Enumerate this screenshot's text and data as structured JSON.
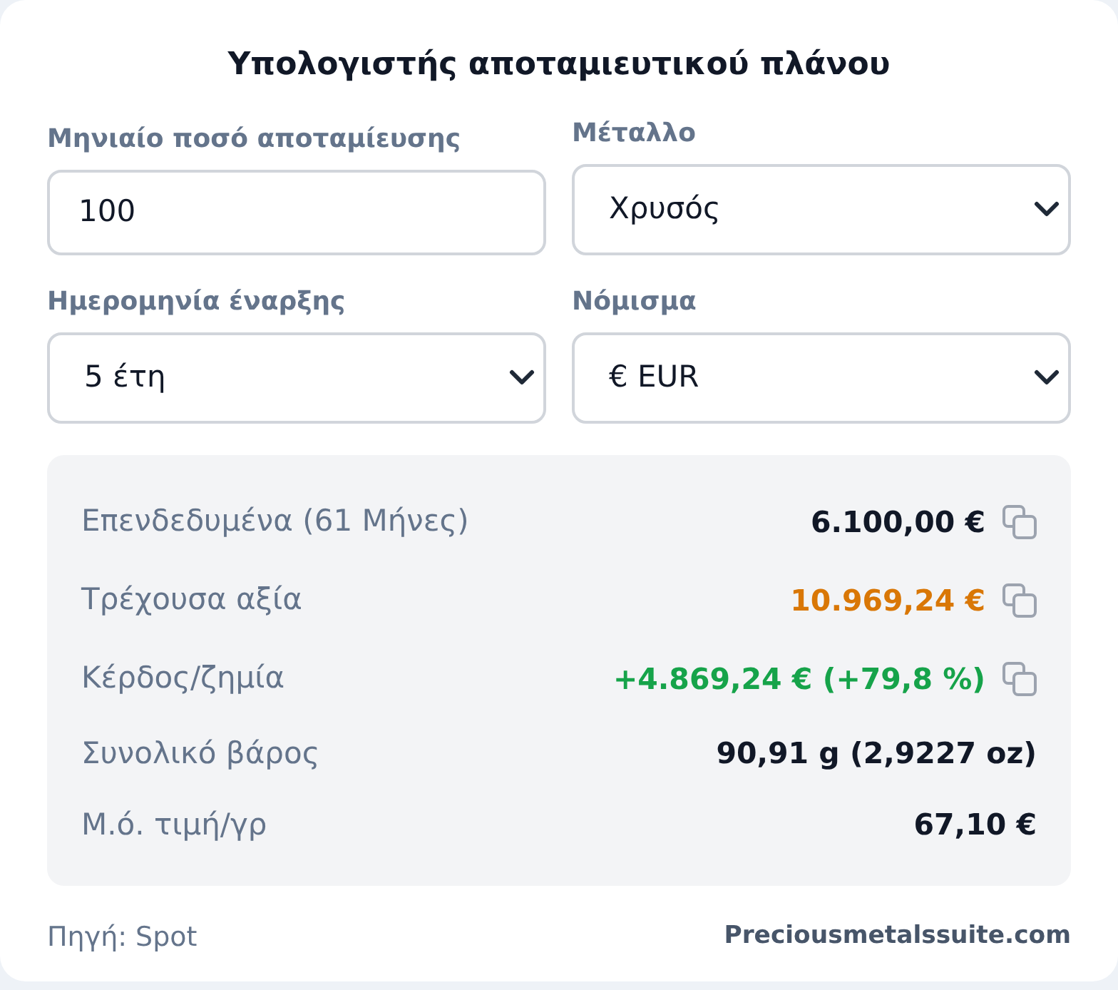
{
  "title": "Υπολογιστής αποταμιευτικού πλάνου",
  "fields": [
    {
      "kind": "input",
      "label": "Μηνιαίο ποσό αποταμίευσης",
      "value": "100"
    },
    {
      "kind": "select",
      "label": "Μέταλλο",
      "value": "Χρυσός"
    },
    {
      "kind": "select",
      "label": "Ημερομηνία έναρξης",
      "value": "5 έτη"
    },
    {
      "kind": "select",
      "label": "Νόμισμα",
      "value": "€ EUR"
    }
  ],
  "results": [
    {
      "label": "Επενδεδυμένα (61 Μήνες)",
      "value": "6.100,00 €",
      "color": "#111827",
      "copyable": true
    },
    {
      "label": "Τρέχουσα αξία",
      "value": "10.969,24 €",
      "color": "#d97706",
      "copyable": true
    },
    {
      "label": "Κέρδος/ζημία",
      "value": "+4.869,24 € (+79,8 %)",
      "color": "#16a34a",
      "copyable": true
    },
    {
      "label": "Συνολικό βάρος",
      "value": "90,91 g (2,9227 oz)",
      "color": "#111827",
      "copyable": false
    },
    {
      "label": "Μ.ό. τιμή/γρ",
      "value": "67,10 €",
      "color": "#111827",
      "copyable": false
    }
  ],
  "footer": {
    "source": "Πηγή: Spot",
    "site": "Preciousmetalssuite.com"
  }
}
